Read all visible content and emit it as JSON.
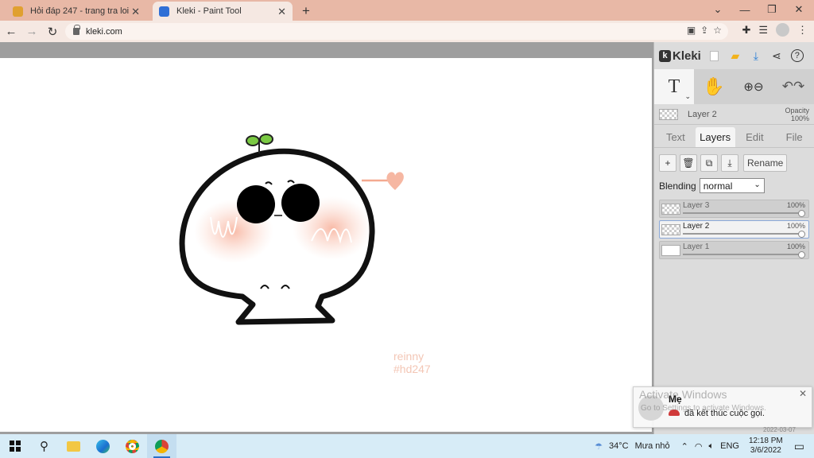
{
  "browser": {
    "tabs": [
      {
        "title": "Hỏi đáp 247 - trang tra loi",
        "active": false,
        "favicon_color": "#e0a030"
      },
      {
        "title": "Kleki - Paint Tool",
        "active": true,
        "favicon_color": "#2f6fd6"
      }
    ],
    "new_tab": "+",
    "url": "kleki.com",
    "window_controls": [
      "⌄",
      "—",
      "❐",
      "✕"
    ]
  },
  "canvas": {
    "signature_line1": "reinny",
    "signature_line2": "#hd247"
  },
  "panel": {
    "logo": "Kleki",
    "top_icons": [
      "new-image-icon",
      "open-folder-icon",
      "download-icon",
      "share-icon",
      "help-icon"
    ],
    "tools": [
      {
        "name": "text-tool",
        "glyph": "T",
        "active": true
      },
      {
        "name": "hand-tool",
        "glyph": "✋",
        "active": false
      },
      {
        "name": "zoom-tool",
        "glyph": "⊕⊖",
        "active": false
      },
      {
        "name": "undo-redo",
        "glyph": "↶↷",
        "active": false
      }
    ],
    "current_layer": "Layer 2",
    "opacity_label": "Opacity",
    "opacity_value": "100%",
    "tabs": [
      "Text",
      "Layers",
      "Edit",
      "File"
    ],
    "active_tab": "Layers",
    "actions": [
      "+",
      "🗑",
      "⧉",
      "⤓"
    ],
    "rename_label": "Rename",
    "blending_label": "Blending",
    "blending_value": "normal",
    "layers": [
      {
        "name": "Layer 3",
        "opacity": "100%",
        "active": false,
        "thumb": "checker"
      },
      {
        "name": "Layer 2",
        "opacity": "100%",
        "active": true,
        "thumb": "checker"
      },
      {
        "name": "Layer 1",
        "opacity": "100%",
        "active": false,
        "thumb": "white"
      }
    ]
  },
  "notification": {
    "sender": "Mẹ",
    "message": "đã kết thúc cuộc gọi.",
    "watermark_title": "Activate Windows",
    "watermark_sub": "Go to Settings to activate Windows.",
    "ghost_date": "2022-03-07"
  },
  "taskbar": {
    "temperature": "34°C",
    "weather": "Mưa nhỏ",
    "language": "ENG",
    "time": "12:18 PM",
    "date": "3/6/2022"
  }
}
